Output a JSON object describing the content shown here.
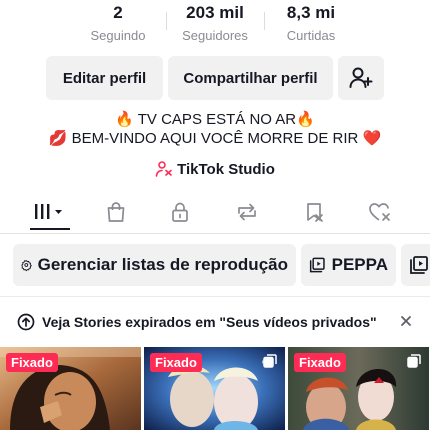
{
  "stats": [
    {
      "value": "2",
      "label": "Seguindo"
    },
    {
      "value": "203 mil",
      "label": "Seguidores"
    },
    {
      "value": "8,3 mi",
      "label": "Curtidas"
    }
  ],
  "buttons": {
    "edit": "Editar perfil",
    "share": "Compartilhar perfil",
    "add_friend_icon": "person-plus-icon"
  },
  "bio": {
    "line1": "🔥 TV CAPS ESTÁ NO AR🔥",
    "line2": "💋 BEM-VINDO AQUI VOCÊ MORRE DE RIR ❤️"
  },
  "studio": {
    "label": "TikTok Studio",
    "icon": "studio-person-icon"
  },
  "tabs": [
    {
      "icon": "videos-grid-icon",
      "active": true
    },
    {
      "icon": "shop-bag-icon"
    },
    {
      "icon": "lock-icon"
    },
    {
      "icon": "repost-icon"
    },
    {
      "icon": "favorites-icon"
    },
    {
      "icon": "liked-heart-icon"
    }
  ],
  "playlists": {
    "manage": "Gerenciar listas de reprodução",
    "items": [
      "PEPPA"
    ]
  },
  "banner": {
    "text": "Veja Stories expirados em \"Seus vídeos privados\""
  },
  "thumbnails": [
    {
      "badge": "Fixado"
    },
    {
      "badge": "Fixado"
    },
    {
      "badge": "Fixado"
    }
  ],
  "colors": {
    "accent": "#fe2c55",
    "text": "#161823",
    "muted": "#8a8b91",
    "button_bg": "#f1f1f2"
  }
}
